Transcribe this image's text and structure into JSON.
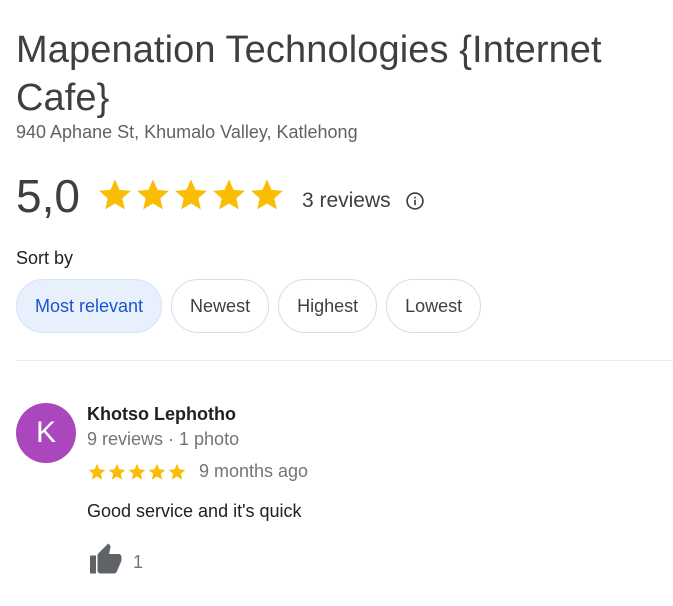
{
  "place": {
    "title": "Mapenation Technologies {Internet Cafe}",
    "address": "940 Aphane St, Khumalo Valley, Katlehong"
  },
  "summary": {
    "rating": "5,0",
    "stars": 5,
    "reviews_count": "3 reviews",
    "info_icon": "info-icon"
  },
  "sort": {
    "label": "Sort by",
    "options": [
      {
        "label": "Most relevant",
        "selected": true
      },
      {
        "label": "Newest",
        "selected": false
      },
      {
        "label": "Highest",
        "selected": false
      },
      {
        "label": "Lowest",
        "selected": false
      }
    ]
  },
  "reviews": [
    {
      "avatar_letter": "K",
      "avatar_color": "#ab47bc",
      "name": "Khotso Lephotho",
      "meta": "9 reviews · 1 photo",
      "stars": 5,
      "date": "9 months ago",
      "text": "Good service and it's quick",
      "likes": "1",
      "like_icon": "thumbs-up-icon"
    }
  ],
  "colors": {
    "star": "#fbbc04",
    "selected_chip_bg": "#e8f0fe",
    "selected_chip_text": "#1a56c9"
  }
}
